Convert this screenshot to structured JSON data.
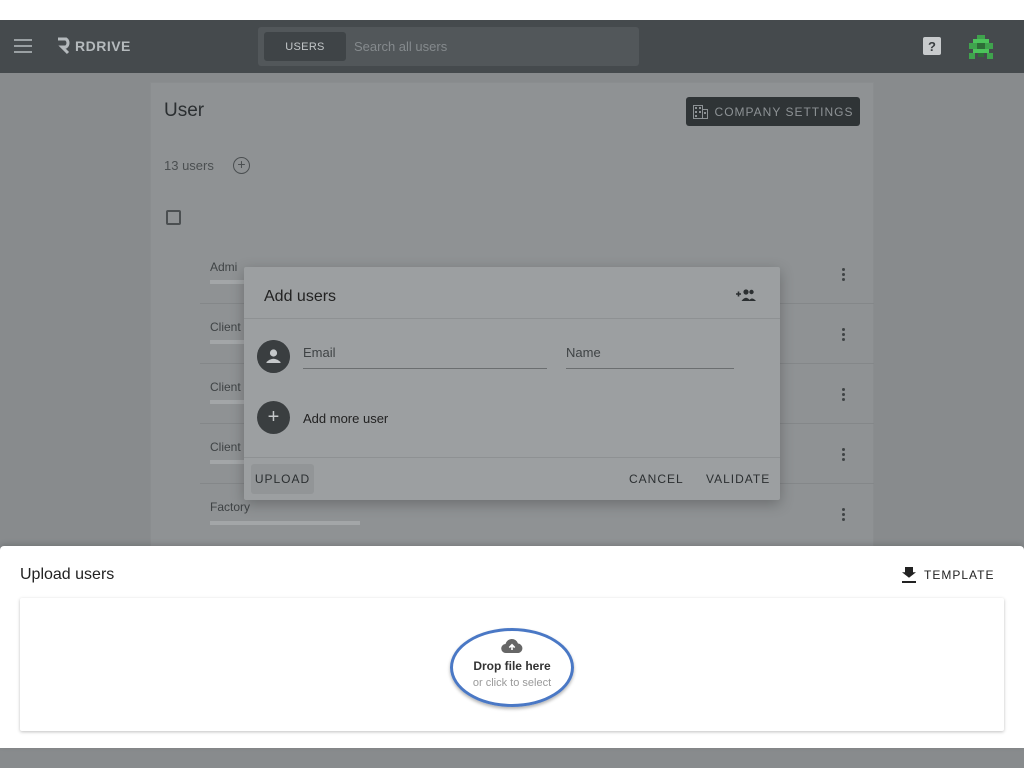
{
  "header": {
    "brand": "RDRIVE",
    "search_scope": "USERS",
    "search_placeholder": "Search all users",
    "help_label": "?"
  },
  "page": {
    "title": "User",
    "company_settings_label": "COMPANY SETTINGS",
    "user_count": "13 users",
    "add_label": "+",
    "rows": [
      {
        "name": "Admi"
      },
      {
        "name": "Client"
      },
      {
        "name": "Client"
      },
      {
        "name": "Client"
      },
      {
        "name": "Factory"
      }
    ]
  },
  "dialog": {
    "title": "Add users",
    "email_placeholder": "Email",
    "name_placeholder": "Name",
    "add_more_icon": "+",
    "add_more_label": "Add more user",
    "upload_label": "UPLOAD",
    "cancel_label": "CANCEL",
    "validate_label": "VALIDATE"
  },
  "sheet": {
    "title": "Upload users",
    "template_label": "TEMPLATE",
    "drop_title": "Drop file here",
    "drop_subtitle": "or click to select"
  },
  "colors": {
    "appbar": "#454a4d",
    "highlight_ring": "#4a78c5"
  }
}
